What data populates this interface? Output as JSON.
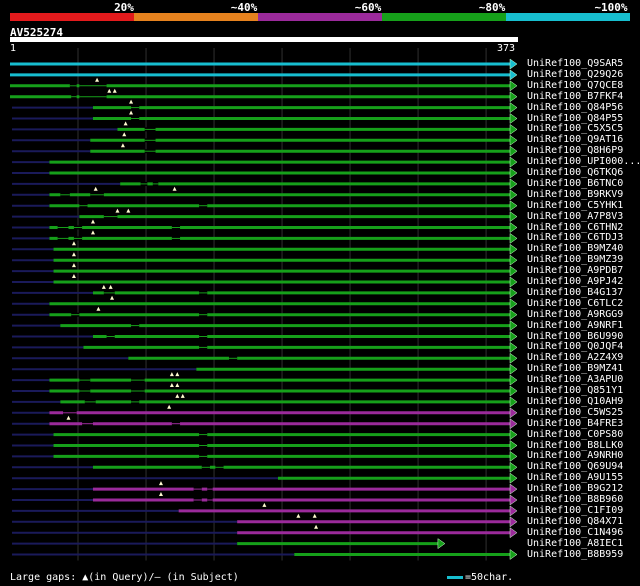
{
  "legend": {
    "labels": [
      "20%",
      "~40%",
      "~60%",
      "~80%",
      "~100%"
    ],
    "colors": [
      "#e31a1c",
      "#e6821e",
      "#9b2a9b",
      "#16a01a",
      "#17becf"
    ]
  },
  "query": {
    "id": "AV525274",
    "start": "1",
    "end": "373",
    "length": 373
  },
  "hits": [
    {
      "name": "UniRef100_Q9SAR5",
      "color": "#17becf",
      "start": 1,
      "end": 373,
      "lead": 30,
      "gaps": [],
      "ins": []
    },
    {
      "name": "UniRef100_Q29Q26",
      "color": "#17becf",
      "start": 1,
      "end": 373,
      "lead": 30,
      "gaps": [],
      "ins": []
    },
    {
      "name": "UniRef100_Q7QCE8",
      "color": "#16a01a",
      "start": 1,
      "end": 373,
      "lead": 30,
      "gaps": [
        [
          45,
          50
        ],
        [
          52,
          72
        ]
      ],
      "ins": [
        65
      ]
    },
    {
      "name": "UniRef100_B7FKF4",
      "color": "#16a01a",
      "start": 1,
      "end": 373,
      "lead": 30,
      "gaps": [
        [
          46,
          50
        ],
        [
          52,
          72
        ]
      ],
      "ins": [
        74,
        78
      ]
    },
    {
      "name": "UniRef100_Q84P56",
      "color": "#16a01a",
      "start": 62,
      "end": 373,
      "lead": 30,
      "gaps": [
        [
          90,
          96
        ]
      ],
      "ins": [
        90
      ]
    },
    {
      "name": "UniRef100_Q84P55",
      "color": "#16a01a",
      "start": 62,
      "end": 373,
      "lead": 30,
      "gaps": [
        [
          90,
          96
        ]
      ],
      "ins": [
        90
      ]
    },
    {
      "name": "UniRef100_C5X5C5",
      "color": "#16a01a",
      "start": 80,
      "end": 373,
      "lead": 30,
      "gaps": [
        [
          100,
          108
        ]
      ],
      "ins": [
        86
      ]
    },
    {
      "name": "UniRef100_Q9AT16",
      "color": "#16a01a",
      "start": 60,
      "end": 373,
      "lead": 30,
      "gaps": [
        [
          100,
          108
        ]
      ],
      "ins": [
        85
      ]
    },
    {
      "name": "UniRef100_Q8H6P9",
      "color": "#16a01a",
      "start": 60,
      "end": 373,
      "lead": 30,
      "gaps": [
        [
          100,
          108
        ]
      ],
      "ins": [
        84
      ]
    },
    {
      "name": "UniRef100_UPI000...",
      "color": "#16a01a",
      "start": 30,
      "end": 373,
      "lead": 30,
      "gaps": [],
      "ins": []
    },
    {
      "name": "UniRef100_Q6TKQ6",
      "color": "#16a01a",
      "start": 30,
      "end": 373,
      "lead": 30,
      "gaps": [],
      "ins": []
    },
    {
      "name": "UniRef100_B6TNC0",
      "color": "#16a01a",
      "start": 82,
      "end": 373,
      "lead": 30,
      "gaps": [
        [
          97,
          102
        ],
        [
          106,
          110
        ]
      ],
      "ins": []
    },
    {
      "name": "UniRef100_B9RKV9",
      "color": "#16a01a",
      "start": 30,
      "end": 373,
      "lead": 30,
      "gaps": [
        [
          38,
          45
        ],
        [
          60,
          70
        ]
      ],
      "ins": [
        64,
        122
      ]
    },
    {
      "name": "UniRef100_C5YHK1",
      "color": "#16a01a",
      "start": 30,
      "end": 373,
      "lead": 30,
      "gaps": [
        [
          52,
          58
        ],
        [
          140,
          146
        ]
      ],
      "ins": []
    },
    {
      "name": "UniRef100_A7P8V3",
      "color": "#16a01a",
      "start": 52,
      "end": 373,
      "lead": 30,
      "gaps": [
        [
          70,
          80
        ]
      ],
      "ins": [
        80,
        88
      ]
    },
    {
      "name": "UniRef100_C6THN2",
      "color": "#16a01a",
      "start": 30,
      "end": 373,
      "lead": 30,
      "gaps": [
        [
          36,
          44
        ],
        [
          48,
          54
        ],
        [
          120,
          126
        ]
      ],
      "ins": [
        62
      ]
    },
    {
      "name": "UniRef100_C6TDJ3",
      "color": "#16a01a",
      "start": 30,
      "end": 373,
      "lead": 30,
      "gaps": [
        [
          36,
          44
        ],
        [
          48,
          54
        ],
        [
          120,
          126
        ]
      ],
      "ins": [
        62
      ]
    },
    {
      "name": "UniRef100_B9MZ40",
      "color": "#16a01a",
      "start": 33,
      "end": 373,
      "lead": 30,
      "gaps": [],
      "ins": [
        48
      ]
    },
    {
      "name": "UniRef100_B9MZ39",
      "color": "#16a01a",
      "start": 33,
      "end": 373,
      "lead": 30,
      "gaps": [],
      "ins": [
        48
      ]
    },
    {
      "name": "UniRef100_A9PDB7",
      "color": "#16a01a",
      "start": 33,
      "end": 373,
      "lead": 30,
      "gaps": [],
      "ins": [
        48
      ]
    },
    {
      "name": "UniRef100_A9PJ42",
      "color": "#16a01a",
      "start": 33,
      "end": 373,
      "lead": 30,
      "gaps": [],
      "ins": [
        48
      ]
    },
    {
      "name": "UniRef100_B4G137",
      "color": "#16a01a",
      "start": 62,
      "end": 373,
      "lead": 30,
      "gaps": [
        [
          70,
          78
        ],
        [
          140,
          146
        ]
      ],
      "ins": [
        70,
        75
      ]
    },
    {
      "name": "UniRef100_C6TLC2",
      "color": "#16a01a",
      "start": 30,
      "end": 373,
      "lead": 30,
      "gaps": [],
      "ins": [
        76
      ]
    },
    {
      "name": "UniRef100_A9RGG9",
      "color": "#16a01a",
      "start": 30,
      "end": 373,
      "lead": 30,
      "gaps": [
        [
          46,
          52
        ],
        [
          140,
          146
        ]
      ],
      "ins": [
        66
      ]
    },
    {
      "name": "UniRef100_A9NRF1",
      "color": "#16a01a",
      "start": 38,
      "end": 373,
      "lead": 30,
      "gaps": [
        [
          90,
          96
        ]
      ],
      "ins": []
    },
    {
      "name": "UniRef100_B6U990",
      "color": "#16a01a",
      "start": 62,
      "end": 373,
      "lead": 30,
      "gaps": [
        [
          72,
          78
        ],
        [
          140,
          146
        ]
      ],
      "ins": []
    },
    {
      "name": "UniRef100_Q0JQF4",
      "color": "#16a01a",
      "start": 55,
      "end": 373,
      "lead": 30,
      "gaps": [
        [
          140,
          146
        ]
      ],
      "ins": []
    },
    {
      "name": "UniRef100_A2Z4X9",
      "color": "#16a01a",
      "start": 88,
      "end": 373,
      "lead": 30,
      "gaps": [
        [
          162,
          168
        ]
      ],
      "ins": []
    },
    {
      "name": "UniRef100_B9MZ41",
      "color": "#16a01a",
      "start": 138,
      "end": 373,
      "lead": 30,
      "gaps": [],
      "ins": []
    },
    {
      "name": "UniRef100_A3APU0",
      "color": "#16a01a",
      "start": 30,
      "end": 373,
      "lead": 30,
      "gaps": [
        [
          52,
          60
        ],
        [
          90,
          100
        ]
      ],
      "ins": [
        120,
        124
      ]
    },
    {
      "name": "UniRef100_Q851Y1",
      "color": "#16a01a",
      "start": 30,
      "end": 373,
      "lead": 30,
      "gaps": [
        [
          52,
          60
        ],
        [
          90,
          100
        ]
      ],
      "ins": [
        120,
        124
      ]
    },
    {
      "name": "UniRef100_Q10AH9",
      "color": "#16a01a",
      "start": 38,
      "end": 373,
      "lead": 30,
      "gaps": [
        [
          56,
          64
        ],
        [
          90,
          96
        ]
      ],
      "ins": [
        124,
        128
      ]
    },
    {
      "name": "UniRef100_C5WS25",
      "color": "#9b2a9b",
      "start": 30,
      "end": 373,
      "lead": 30,
      "gaps": [
        [
          40,
          50
        ]
      ],
      "ins": [
        118
      ]
    },
    {
      "name": "UniRef100_B4FRE3",
      "color": "#9b2a9b",
      "start": 30,
      "end": 373,
      "lead": 30,
      "gaps": [
        [
          54,
          62
        ],
        [
          120,
          126
        ]
      ],
      "ins": [
        44
      ]
    },
    {
      "name": "UniRef100_C0PS80",
      "color": "#16a01a",
      "start": 33,
      "end": 373,
      "lead": 30,
      "gaps": [
        [
          140,
          146
        ]
      ],
      "ins": []
    },
    {
      "name": "UniRef100_B8LLK0",
      "color": "#16a01a",
      "start": 33,
      "end": 373,
      "lead": 30,
      "gaps": [
        [
          140,
          146
        ]
      ],
      "ins": []
    },
    {
      "name": "UniRef100_A9NRH0",
      "color": "#16a01a",
      "start": 33,
      "end": 373,
      "lead": 30,
      "gaps": [
        [
          140,
          146
        ]
      ],
      "ins": []
    },
    {
      "name": "UniRef100_Q69U94",
      "color": "#16a01a",
      "start": 62,
      "end": 373,
      "lead": 30,
      "gaps": [
        [
          142,
          148
        ],
        [
          152,
          158
        ]
      ],
      "ins": []
    },
    {
      "name": "UniRef100_A9U155",
      "color": "#16a01a",
      "start": 198,
      "end": 373,
      "lead": 30,
      "gaps": [],
      "ins": []
    },
    {
      "name": "UniRef100_B9G212",
      "color": "#9b2a9b",
      "start": 62,
      "end": 373,
      "lead": 30,
      "gaps": [
        [
          136,
          142
        ],
        [
          146,
          150
        ]
      ],
      "ins": [
        112
      ]
    },
    {
      "name": "UniRef100_B8B960",
      "color": "#9b2a9b",
      "start": 62,
      "end": 373,
      "lead": 30,
      "gaps": [
        [
          136,
          142
        ],
        [
          146,
          150
        ]
      ],
      "ins": [
        112
      ]
    },
    {
      "name": "UniRef100_C1FI09",
      "color": "#9b2a9b",
      "start": 125,
      "end": 373,
      "lead": 30,
      "gaps": [],
      "ins": [
        188
      ]
    },
    {
      "name": "UniRef100_Q84X71",
      "color": "#9b2a9b",
      "start": 168,
      "end": 373,
      "lead": 30,
      "gaps": [],
      "ins": [
        213,
        225
      ]
    },
    {
      "name": "UniRef100_C1N496",
      "color": "#9b2a9b",
      "start": 168,
      "end": 373,
      "lead": 30,
      "gaps": [],
      "ins": [
        226
      ]
    },
    {
      "name": "UniRef100_A8IEC1",
      "color": "#16a01a",
      "start": 168,
      "end": 320,
      "lead": 30,
      "gaps": [],
      "ins": []
    },
    {
      "name": "UniRef100_B8B959",
      "color": "#16a01a",
      "start": 210,
      "end": 373,
      "lead": 30,
      "gaps": [],
      "ins": []
    }
  ],
  "footer": {
    "gaps_text": "Large gaps: ▲(in Query)/– (in Subject)",
    "scale_text": "=50char.",
    "scale_color": "#17becf"
  }
}
